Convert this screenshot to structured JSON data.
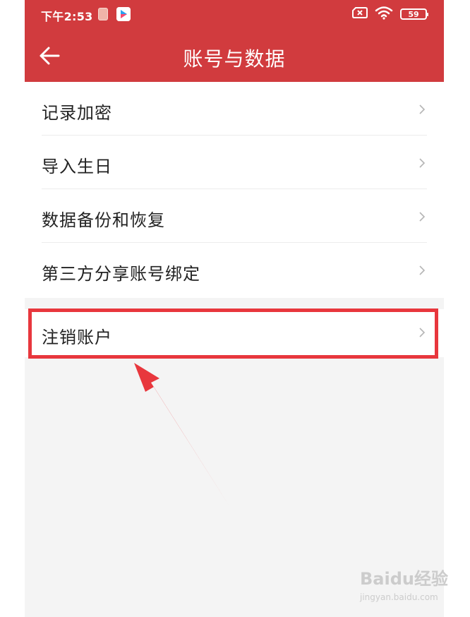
{
  "status_bar": {
    "time": "下午2:53",
    "battery": "59"
  },
  "nav": {
    "title": "账号与数据"
  },
  "menu": {
    "group1": [
      {
        "label": "记录加密"
      },
      {
        "label": "导入生日"
      },
      {
        "label": "数据备份和恢复"
      },
      {
        "label": "第三方分享账号绑定"
      }
    ],
    "group2": [
      {
        "label": "注销账户"
      }
    ]
  },
  "watermark": {
    "brand": "Baidu经验",
    "url": "jingyan.baidu.com"
  },
  "colors": {
    "header": "#d13b3e",
    "highlight": "#e8373d",
    "background": "#f4f4f4"
  }
}
